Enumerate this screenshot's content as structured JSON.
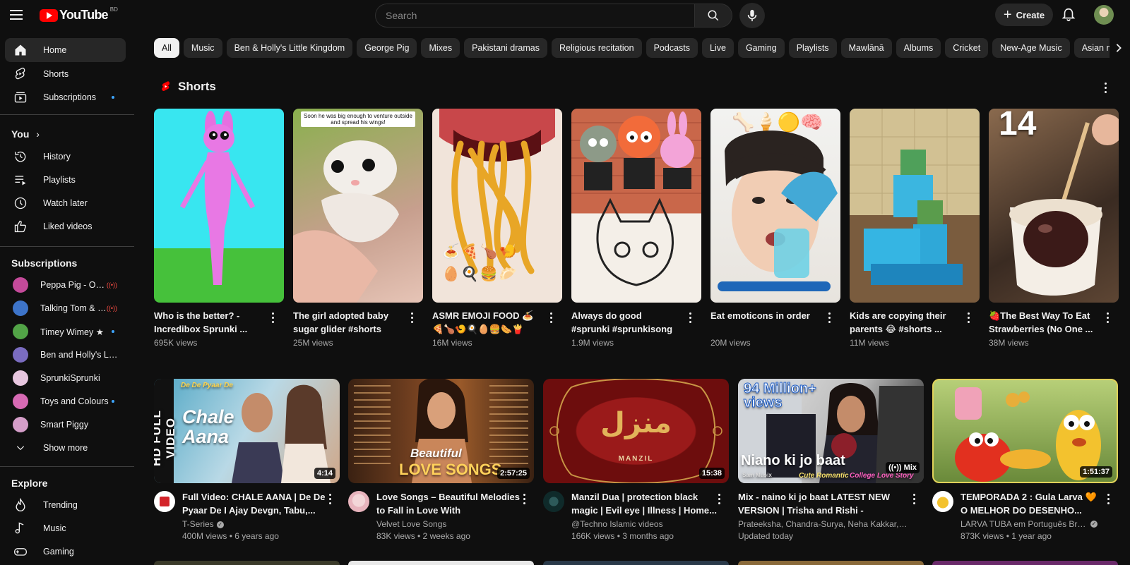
{
  "header": {
    "logo_text": "YouTube",
    "region": "BD",
    "search_placeholder": "Search",
    "create_label": "Create"
  },
  "sidebar": {
    "main": [
      {
        "label": "Home",
        "icon": "home-icon",
        "active": true
      },
      {
        "label": "Shorts",
        "icon": "shorts-icon"
      },
      {
        "label": "Subscriptions",
        "icon": "subscriptions-icon"
      }
    ],
    "you_title": "You",
    "you": [
      {
        "label": "History",
        "icon": "history-icon"
      },
      {
        "label": "Playlists",
        "icon": "playlists-icon"
      },
      {
        "label": "Watch later",
        "icon": "watch-later-icon"
      },
      {
        "label": "Liked videos",
        "icon": "like-icon"
      }
    ],
    "subscriptions_title": "Subscriptions",
    "subscriptions": [
      {
        "label": "Peppa Pig - Official Channel",
        "color": "#c44a9a",
        "status": "live"
      },
      {
        "label": "Talking Tom & Friends",
        "color": "#3d74c9",
        "status": "live"
      },
      {
        "label": "Timey Wimey ★",
        "color": "#52a447",
        "status": "dot"
      },
      {
        "label": "Ben and Holly's Little Kingdom",
        "color": "#7a6cc0",
        "status": "none"
      },
      {
        "label": "SprunkiSprunki",
        "color": "#e7c6df",
        "status": "none"
      },
      {
        "label": "Toys and Colours",
        "color": "#d76ab4",
        "status": "dot"
      },
      {
        "label": "Smart Piggy",
        "color": "#d59ec9",
        "status": "none"
      }
    ],
    "show_more": "Show more",
    "explore_title": "Explore",
    "explore": [
      {
        "label": "Trending",
        "icon": "trending-icon"
      },
      {
        "label": "Music",
        "icon": "music-icon"
      },
      {
        "label": "Gaming",
        "icon": "gaming-icon"
      }
    ]
  },
  "chips": [
    "All",
    "Music",
    "Ben & Holly's Little Kingdom",
    "George Pig",
    "Mixes",
    "Pakistani dramas",
    "Religious recitation",
    "Podcasts",
    "Live",
    "Gaming",
    "Playlists",
    "Mawlānā",
    "Albums",
    "Cricket",
    "New-Age Music",
    "Asian music"
  ],
  "shorts": {
    "title": "Shorts",
    "items": [
      {
        "title": "Who is the better? - Incredibox Sprunki ...",
        "views": "695K views"
      },
      {
        "title": "The girl adopted baby sugar glider #shorts",
        "views": "25M views",
        "caption": "Soon he was big enough to venture outside and spread his wings!"
      },
      {
        "title": "ASMR EMOJI FOOD 🍝 🍕🍗🍤🍳🥚🍔🌭🍟",
        "views": "16M views"
      },
      {
        "title": "Always do good #sprunki #sprunkisong #painting...",
        "views": "1.9M views"
      },
      {
        "title": "Eat emoticons in order",
        "views": "20M views",
        "emojis": "🦴🍦🟡🧠"
      },
      {
        "title": "Kids are copying their parents 😂 #shorts ...",
        "views": "11M views"
      },
      {
        "title": "🍓The Best Way To Eat Strawberries (No One ...",
        "views": "38M views",
        "overlay": "14"
      }
    ]
  },
  "videos": [
    {
      "title": "Full Video: CHALE AANA | De De Pyaar De I Ajay Devgn, Tabu,...",
      "channel": "T-Series",
      "verified": true,
      "stats": "400M views • 6 years ago",
      "duration": "4:14",
      "overlay_side": "HD FULL VIDEO",
      "overlay_main": "Chale Aana",
      "overlay_top": "De De Pyaar De"
    },
    {
      "title": "Love Songs – Beautiful Melodies to Fall in Love With",
      "channel": "Velvet Love Songs",
      "verified": false,
      "stats": "83K views • 2 weeks ago",
      "duration": "2:57:25",
      "overlay_small": "Beautiful",
      "overlay_main": "LOVE SONGS"
    },
    {
      "title": "Manzil Dua | protection black magic | Evil eye | Illness | Home...",
      "channel": "@Techno Islamic videos",
      "verified": false,
      "stats": "166K views • 3 months ago",
      "duration": "15:38",
      "overlay_main": "منزل",
      "overlay_small": "MANZIL"
    },
    {
      "title": "Mix - naino ki jo baat LATEST NEW VERSION | Trisha and Rishi - AMAZIN...",
      "channel": "Prateeksha, Chandra-Surya, Neha Kakkar, and more",
      "verified": false,
      "stats": "Updated today",
      "duration": "Mix",
      "overlay_top": "94 Million+ views",
      "overlay_main": "Niano ki jo baat",
      "overlay_small": "Sam Musix",
      "overlay_small2": "Cute Romantic",
      "overlay_small3": "College Love Story"
    },
    {
      "title": "TEMPORADA 2 : Gula Larva 🧡 O MELHOR DO DESENHO...",
      "channel": "LARVA TUBA em Português Brasil",
      "verified": true,
      "stats": "873K views • 1 year ago",
      "duration": "1:51:37"
    }
  ],
  "colors": {
    "background": "#0f0f0f",
    "surface": "#272727",
    "accent": "#ff0000",
    "subscription_dot": "#3ea6ff"
  }
}
